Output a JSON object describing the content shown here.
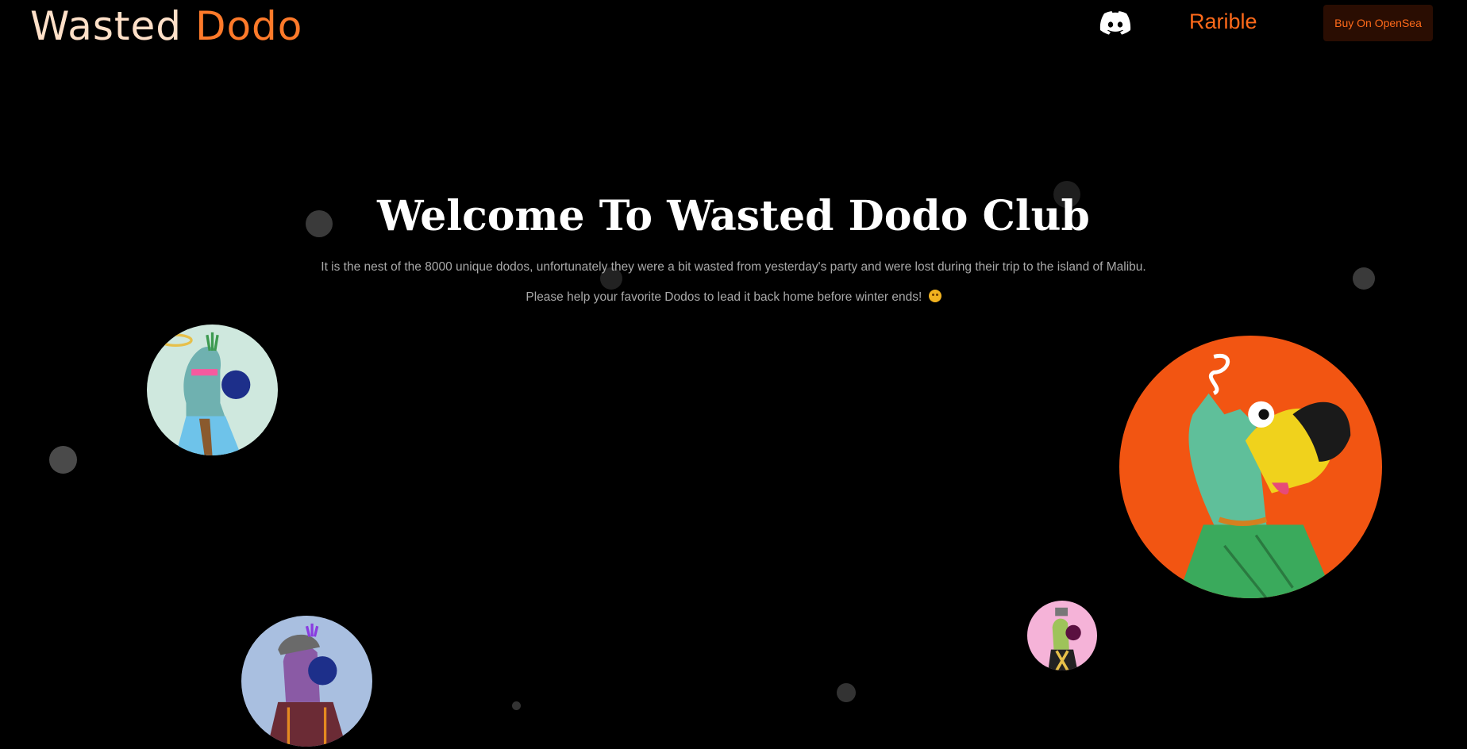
{
  "header": {
    "logo_word1": "Wasted",
    "logo_word2": "Dodo",
    "discord_icon": "discord-icon",
    "rarible_label": "Rarible",
    "buy_label": "Buy On OpenSea"
  },
  "hero": {
    "title": "Welcome To Wasted Dodo Club",
    "paragraph1": "It is the nest of the 8000 unique dodos, unfortunately they were a bit wasted from yesterday's party and were lost during their trip to the island of Malibu.",
    "paragraph2": "Please help your favorite Dodos to lead it back home before winter ends!"
  },
  "colors": {
    "background": "#000000",
    "accent": "#ff6a1a",
    "button_bg": "#2a0d02"
  }
}
